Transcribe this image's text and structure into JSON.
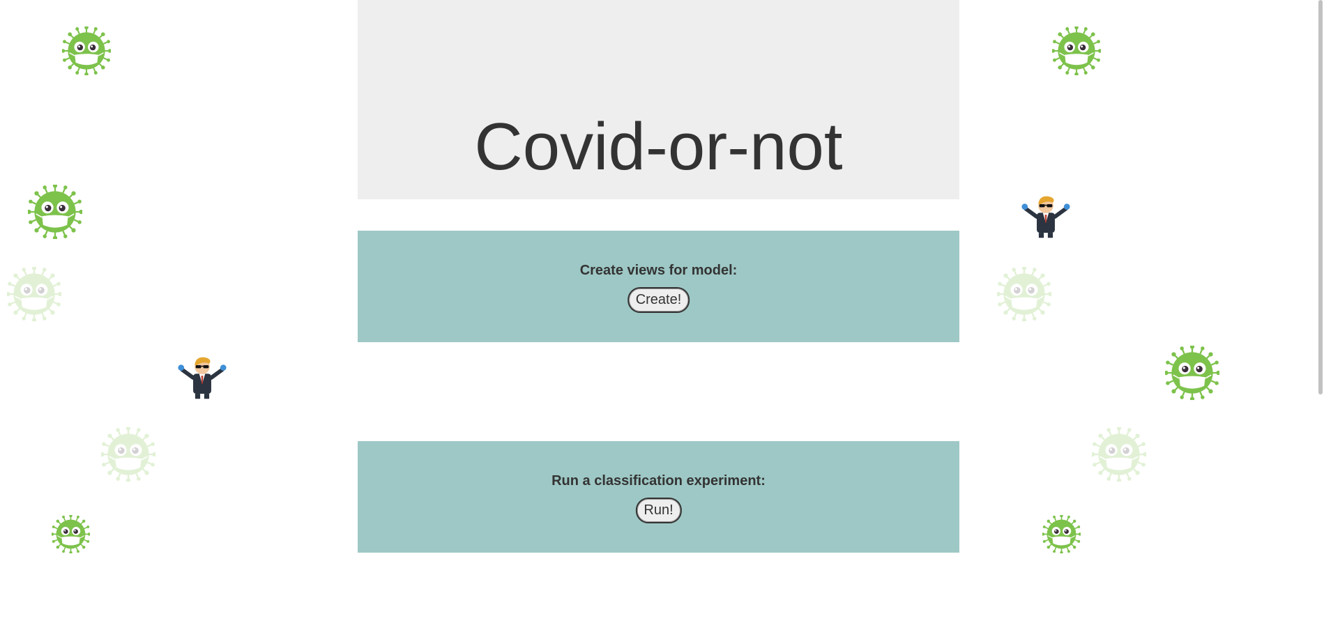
{
  "page": {
    "title": "Covid-or-not"
  },
  "create_panel": {
    "label": "Create views for model:",
    "button_label": "Create!"
  },
  "run_panel": {
    "label": "Run a classification experiment:",
    "button_label": "Run!"
  },
  "colors": {
    "header_bg": "#eeeeee",
    "panel_bg": "#9ec8c5",
    "text": "#333333",
    "virus_green": "#7dc24b"
  },
  "decorations": {
    "sprites": [
      "virus-icon",
      "wallstreet-guy-icon"
    ]
  }
}
